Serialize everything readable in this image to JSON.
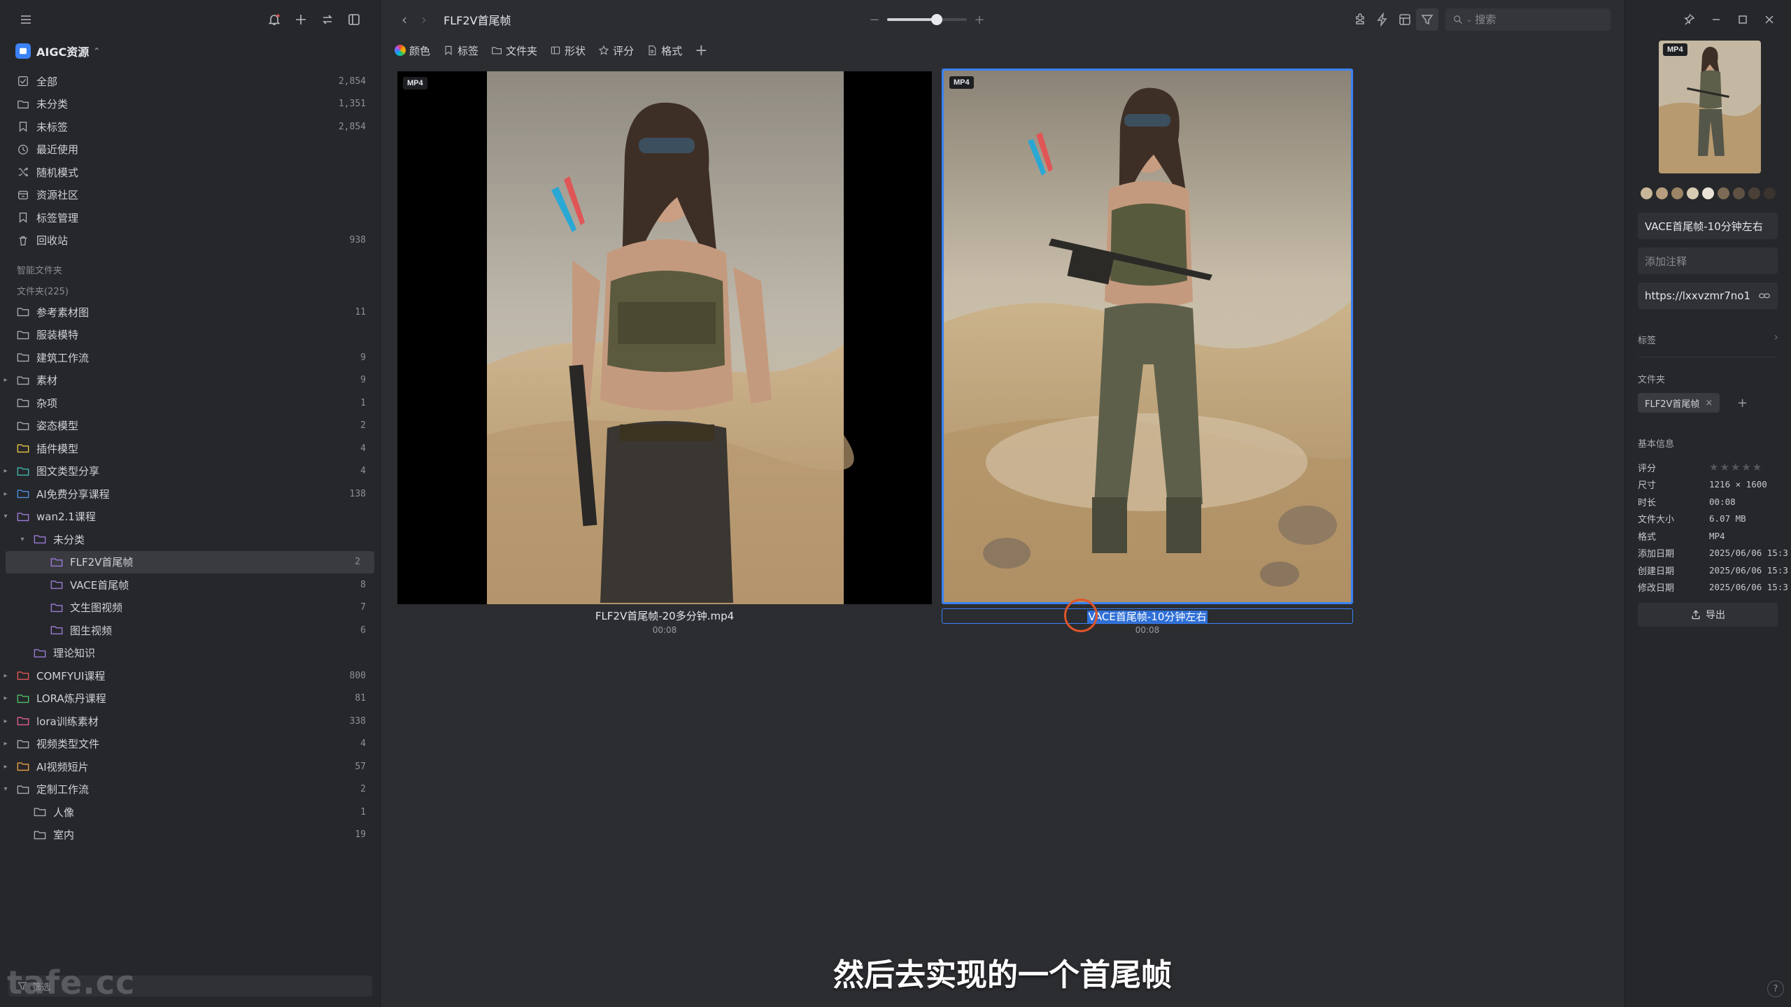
{
  "sidebar": {
    "library": {
      "name": "AIGC资源"
    },
    "nav": [
      {
        "label": "全部",
        "count": "2,854",
        "icon": "all-items-icon"
      },
      {
        "label": "未分类",
        "count": "1,351",
        "icon": "uncategorized-icon"
      },
      {
        "label": "未标签",
        "count": "2,854",
        "icon": "untagged-icon"
      },
      {
        "label": "最近使用",
        "count": "",
        "icon": "clock-icon"
      },
      {
        "label": "随机模式",
        "count": "",
        "icon": "shuffle-icon"
      },
      {
        "label": "资源社区",
        "count": "",
        "icon": "community-icon"
      },
      {
        "label": "标签管理",
        "count": "",
        "icon": "tag-manage-icon"
      },
      {
        "label": "回收站",
        "count": "938",
        "icon": "trash-icon"
      }
    ],
    "smart_folders_label": "智能文件夹",
    "folders_label": "文件夹(225)",
    "folders": [
      {
        "label": "参考素材图",
        "count": "11",
        "depth": 0,
        "caret": "",
        "color": "#a9aaaf"
      },
      {
        "label": "服装模特",
        "count": "",
        "depth": 0,
        "caret": "",
        "color": "#a9aaaf"
      },
      {
        "label": "建筑工作流",
        "count": "9",
        "depth": 0,
        "caret": "",
        "color": "#a9aaaf"
      },
      {
        "label": "素材",
        "count": "9",
        "depth": 0,
        "caret": "right",
        "color": "#a9aaaf"
      },
      {
        "label": "杂项",
        "count": "1",
        "depth": 0,
        "caret": "",
        "color": "#a9aaaf"
      },
      {
        "label": "姿态模型",
        "count": "2",
        "depth": 0,
        "caret": "",
        "color": "#a9aaaf"
      },
      {
        "label": "插件模型",
        "count": "4",
        "depth": 0,
        "caret": "",
        "color": "#e8c547"
      },
      {
        "label": "图文类型分享",
        "count": "4",
        "depth": 0,
        "caret": "right",
        "color": "#3fb8b0"
      },
      {
        "label": "AI免费分享课程",
        "count": "138",
        "depth": 0,
        "caret": "right",
        "color": "#4a8fe0"
      },
      {
        "label": "wan2.1课程",
        "count": "",
        "depth": 0,
        "caret": "down",
        "color": "#9d7bd8"
      },
      {
        "label": "未分类",
        "count": "",
        "depth": 1,
        "caret": "down",
        "color": "#9d7bd8"
      },
      {
        "label": "FLF2V首尾帧",
        "count": "2",
        "depth": 2,
        "caret": "",
        "color": "#9d7bd8",
        "selected": true
      },
      {
        "label": "VACE首尾帧",
        "count": "8",
        "depth": 2,
        "caret": "",
        "color": "#9d7bd8"
      },
      {
        "label": "文生图视频",
        "count": "7",
        "depth": 2,
        "caret": "",
        "color": "#9d7bd8"
      },
      {
        "label": "图生视频",
        "count": "6",
        "depth": 2,
        "caret": "",
        "color": "#9d7bd8"
      },
      {
        "label": "理论知识",
        "count": "",
        "depth": 1,
        "caret": "",
        "color": "#9d7bd8"
      },
      {
        "label": "COMFYUI课程",
        "count": "800",
        "depth": 0,
        "caret": "right",
        "color": "#e05555"
      },
      {
        "label": "LORA炼丹课程",
        "count": "81",
        "depth": 0,
        "caret": "right",
        "color": "#4cbf6b"
      },
      {
        "label": "lora训练素材",
        "count": "338",
        "depth": 0,
        "caret": "right",
        "color": "#e0608f"
      },
      {
        "label": "视频类型文件",
        "count": "4",
        "depth": 0,
        "caret": "right",
        "color": "#a9aaaf"
      },
      {
        "label": "AI视频短片",
        "count": "57",
        "depth": 0,
        "caret": "right",
        "color": "#e8a040"
      },
      {
        "label": "定制工作流",
        "count": "2",
        "depth": 0,
        "caret": "down",
        "color": "#a9aaaf"
      },
      {
        "label": "人像",
        "count": "1",
        "depth": 1,
        "caret": "",
        "color": "#a9aaaf"
      },
      {
        "label": "室内",
        "count": "19",
        "depth": 1,
        "caret": "",
        "color": "#a9aaaf"
      }
    ],
    "filter_placeholder": "筛选",
    "watermark": "tafe.cc"
  },
  "main": {
    "title": "FLF2V首尾帧",
    "zoom_fraction": 0.62,
    "search_placeholder": "搜索",
    "filters": [
      "颜色",
      "标签",
      "文件夹",
      "形状",
      "评分",
      "格式"
    ],
    "items": [
      {
        "badge": "MP4",
        "name": "FLF2V首尾帧-20多分钟.mp4",
        "duration": "00:08"
      },
      {
        "badge": "MP4",
        "name": "VACE首尾帧-10分钟左右",
        "duration": "00:08"
      }
    ],
    "subtitle": "然后去实现的一个首尾帧"
  },
  "inspector": {
    "badge": "MP4",
    "palette": [
      "#c9b79a",
      "#b89e7e",
      "#9c8466",
      "#d8cbb4",
      "#e9e2d6",
      "#7b6a55",
      "#5e5144",
      "#4a4038",
      "#3a332e"
    ],
    "name": "VACE首尾帧-10分钟左右",
    "note_placeholder": "添加注释",
    "url": "https://lxxvzmr7no1",
    "tags_label": "标签",
    "folder_label": "文件夹",
    "folder_tag": "FLF2V首尾帧",
    "basic_info_label": "基本信息",
    "info": [
      {
        "k": "评分",
        "v": ""
      },
      {
        "k": "尺寸",
        "v": "1216 × 1600"
      },
      {
        "k": "时长",
        "v": "00:08"
      },
      {
        "k": "文件大小",
        "v": "6.07 MB"
      },
      {
        "k": "格式",
        "v": "MP4"
      },
      {
        "k": "添加日期",
        "v": "2025/06/06 15:3"
      },
      {
        "k": "创建日期",
        "v": "2025/06/06 15:3"
      },
      {
        "k": "修改日期",
        "v": "2025/06/06 15:3"
      }
    ],
    "rating": 0,
    "export_label": "导出"
  }
}
